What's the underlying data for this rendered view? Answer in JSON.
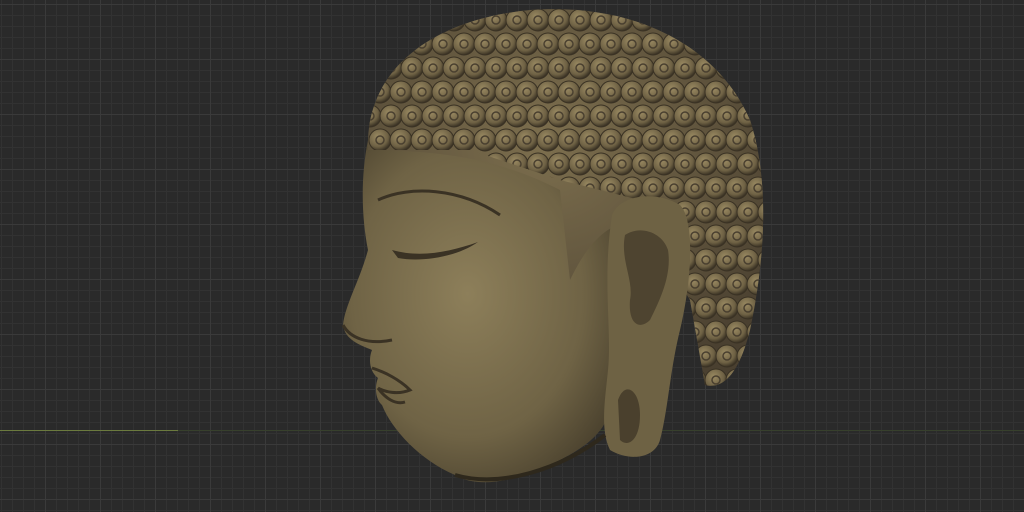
{
  "scene": {
    "subject": "buddha-head-model",
    "colors": {
      "background": "#2a2a2a",
      "grid_minor": "#323232",
      "grid_major": "#3a3a3a",
      "axis": "#6b7a3e",
      "bronze_light": "#8a7c58",
      "bronze_mid": "#6b5f42",
      "bronze_dark": "#3e3626"
    }
  }
}
